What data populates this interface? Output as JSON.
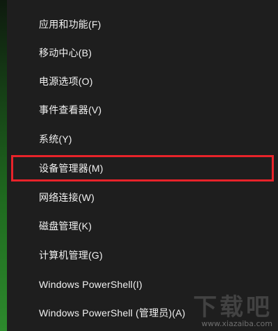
{
  "menu": {
    "items": [
      {
        "label": "应用和功能(F)"
      },
      {
        "label": "移动中心(B)"
      },
      {
        "label": "电源选项(O)"
      },
      {
        "label": "事件查看器(V)"
      },
      {
        "label": "系统(Y)"
      },
      {
        "label": "设备管理器(M)"
      },
      {
        "label": "网络连接(W)"
      },
      {
        "label": "磁盘管理(K)"
      },
      {
        "label": "计算机管理(G)"
      },
      {
        "label": "Windows PowerShell(I)"
      },
      {
        "label": "Windows PowerShell (管理员)(A)"
      }
    ],
    "highlighted_item": "设备管理器(M)",
    "highlight_color": "#e8232a"
  },
  "watermark": {
    "text": "下载吧",
    "url": "www.xiazaiba.com"
  }
}
